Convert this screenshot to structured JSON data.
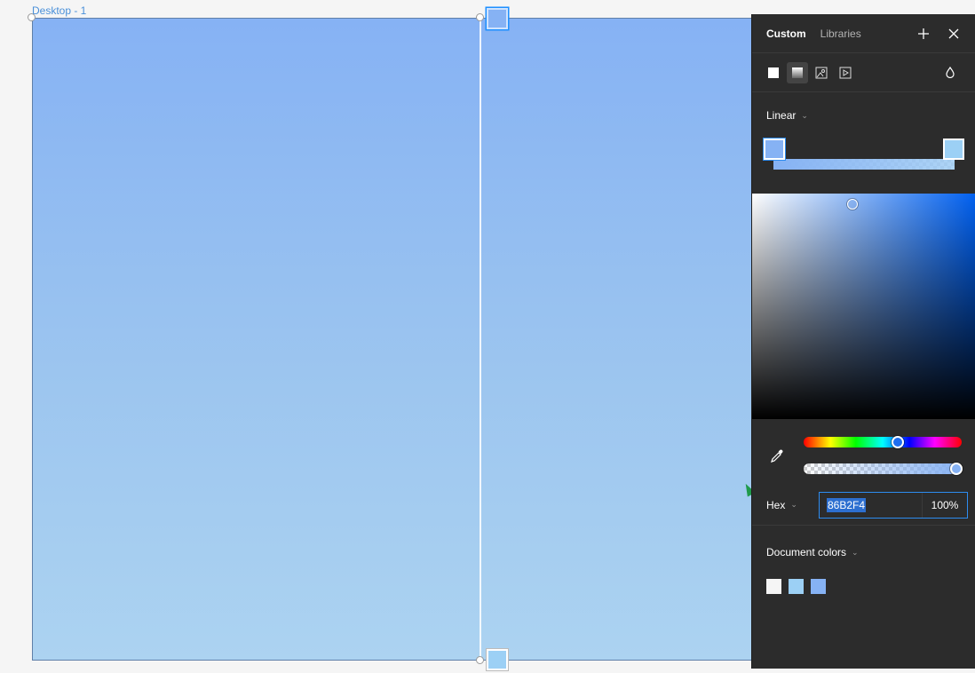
{
  "canvas": {
    "frame_label": "Desktop - 1"
  },
  "panel": {
    "tabs": [
      {
        "label": "Custom",
        "active": true
      },
      {
        "label": "Libraries",
        "active": false
      }
    ],
    "add_icon": "plus-icon",
    "close_icon": "close-icon",
    "fill_types": [
      "solid-fill-icon",
      "gradient-fill-icon",
      "image-fill-icon",
      "video-fill-icon"
    ],
    "blend_icon": "drop-icon",
    "gradient_type": "Linear",
    "gradient_stops": [
      "#86B2F4",
      "#9CD0F5"
    ],
    "color_mode": "Hex",
    "hex_value": "86B2F4",
    "opacity": "100%",
    "document_colors_label": "Document colors",
    "document_colors": [
      "#F5F5F5",
      "#9CD0F5",
      "#86B2F4"
    ]
  }
}
